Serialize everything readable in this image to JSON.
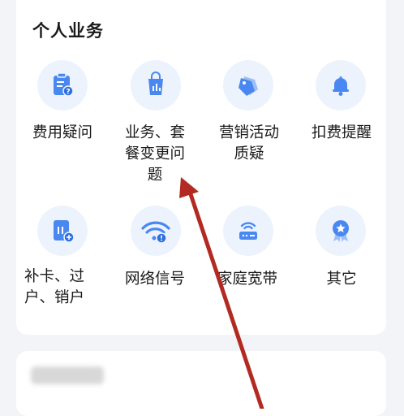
{
  "section": {
    "title": "个人业务"
  },
  "items": [
    {
      "label": "费用疑问",
      "icon": "bill-question-icon"
    },
    {
      "label": "业务、套\n餐变更问\n题",
      "icon": "package-change-icon"
    },
    {
      "label": "营销活动\n质疑",
      "icon": "tags-icon"
    },
    {
      "label": "扣费提醒",
      "icon": "bell-icon"
    },
    {
      "label": "补卡、过\n户、销户",
      "icon": "sim-card-add-icon"
    },
    {
      "label": "网络信号",
      "icon": "wifi-alert-icon"
    },
    {
      "label": "家庭宽带",
      "icon": "router-icon"
    },
    {
      "label": "其它",
      "icon": "badge-star-icon"
    }
  ],
  "colors": {
    "accent": "#4a88f1",
    "icon_bg": "#edf3fd",
    "arrow": "#b22a22"
  }
}
